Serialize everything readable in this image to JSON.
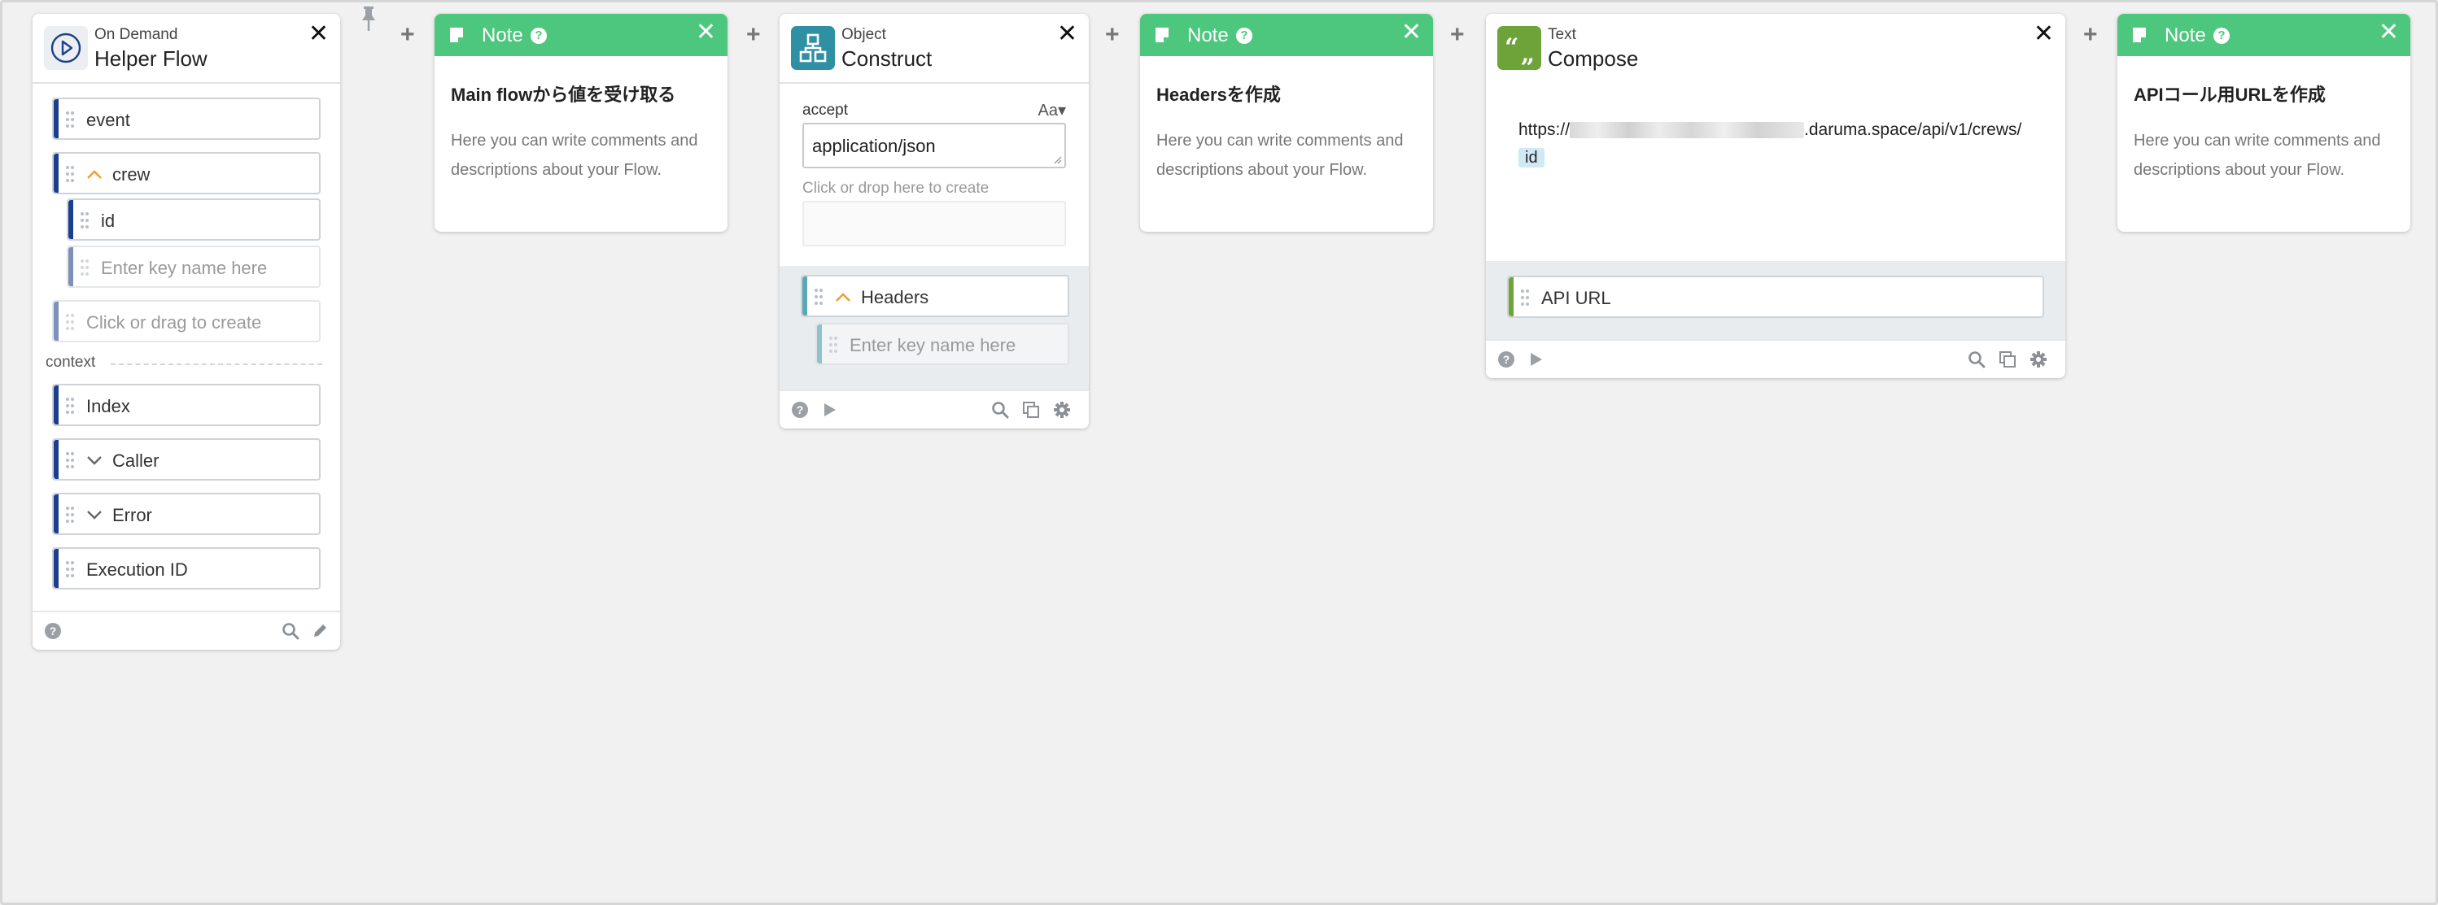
{
  "colors": {
    "note_green": "#4ec77e",
    "field_bar": "#1a3f8f",
    "accent_orange": "#e8a43b"
  },
  "trigger": {
    "kind": "On Demand",
    "title": "Helper Flow",
    "fields": {
      "event": "event",
      "crew": "crew",
      "id": "id",
      "key_placeholder": "Enter key name here",
      "create_placeholder": "Click or drag to create"
    },
    "context_label": "context",
    "context_fields": [
      "Index",
      "Caller",
      "Error",
      "Execution ID"
    ]
  },
  "notes": [
    {
      "label": "Note",
      "heading": "Main flowから値を受け取る",
      "text": "Here you can write comments and descriptions about your Flow."
    },
    {
      "label": "Note",
      "heading": "Headersを作成",
      "text": "Here you can write comments and descriptions about your Flow."
    },
    {
      "label": "Note",
      "heading": "APIコール用URLを作成",
      "text": "Here you can write comments and descriptions about your Flow."
    }
  ],
  "construct": {
    "kind": "Object",
    "title": "Construct",
    "accept_label": "accept",
    "type_toggle": "Aa▾",
    "accept_value": "application/json",
    "create_hint": "Click or drop here to create",
    "output_name": "Headers",
    "key_placeholder": "Enter key name here"
  },
  "compose": {
    "kind": "Text",
    "title": "Compose",
    "url_prefix": "https://",
    "url_suffix": ".daruma.space/api/v1/crews/",
    "url_token": "id",
    "output_name": "API URL"
  },
  "icons": [
    "play-circle-icon",
    "close-icon",
    "note-icon",
    "help-icon",
    "object-icon",
    "quote-icon",
    "search-icon",
    "pencil-icon",
    "copy-icon",
    "gear-icon",
    "play-icon",
    "plus-icon",
    "pin-icon",
    "drag-handle-icon",
    "chevron-up-icon",
    "chevron-down-icon"
  ]
}
